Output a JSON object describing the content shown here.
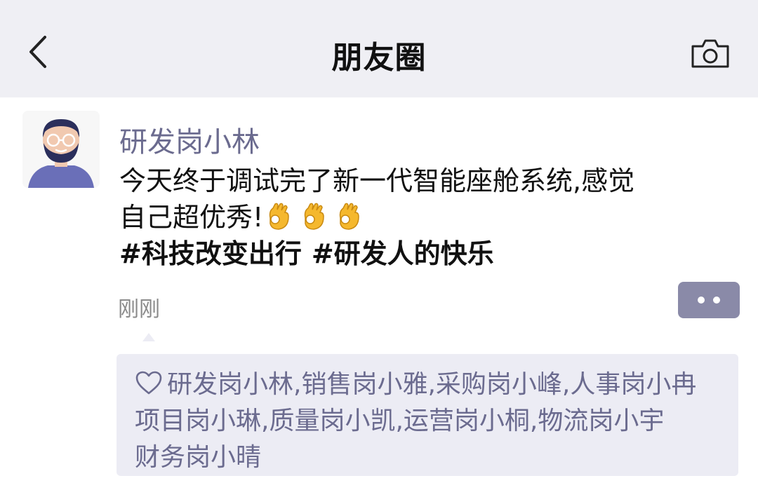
{
  "header": {
    "title": "朋友圈",
    "back_icon": "chevron-left-icon",
    "camera_icon": "camera-icon"
  },
  "post": {
    "username": "研发岗小林",
    "text_line1": "今天终于调试完了新一代智能座舱系统,感觉",
    "text_line2": "自己超优秀!",
    "emojis": [
      "ok-hand-emoji",
      "ok-hand-emoji",
      "ok-hand-emoji"
    ],
    "hashtags": [
      "#科技改变出行",
      "#研发人的快乐"
    ],
    "timestamp": "刚刚",
    "more_icon": "more-dots-icon"
  },
  "likes": {
    "icon": "heart-outline-icon",
    "line1": "研发岗小林,销售岗小雅,采购岗小峰,人事岗小冉",
    "line2": "项目岗小琳,质量岗小凯,运营岗小桐,物流岗小宇",
    "line3": "财务岗小晴"
  },
  "colors": {
    "header_bg": "#efeff4",
    "link": "#6b6b8f",
    "more_button_bg": "#8a8aa8",
    "likes_bg": "#ececf4"
  }
}
